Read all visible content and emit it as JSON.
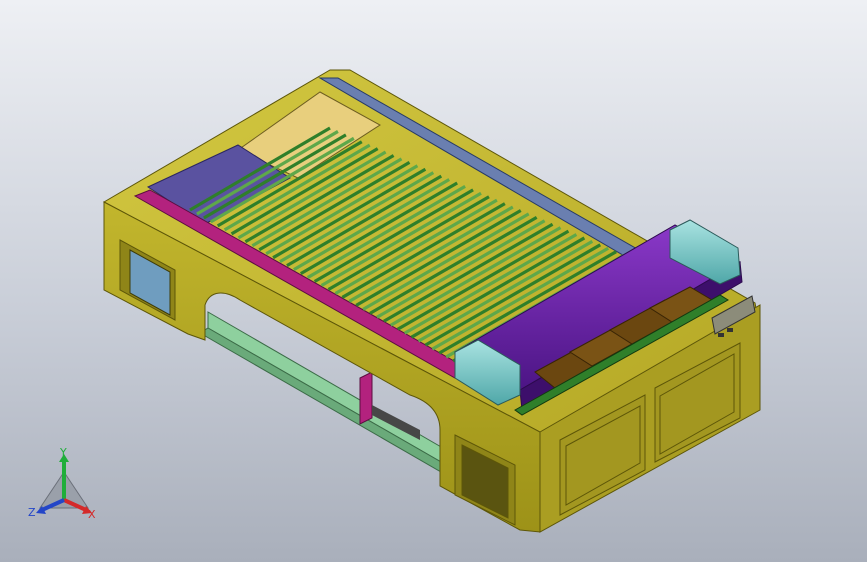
{
  "viewport": {
    "background_top": "#eef0f4",
    "background_bottom": "#a9afbb"
  },
  "colors": {
    "frame": "#b3a623",
    "frame_dark": "#7d7512",
    "frame_top": "#c7bb35",
    "slat_green": "#2f7f2a",
    "slat_light": "#5ea84a",
    "gantry_purple": "#6a1fa6",
    "gantry_dark": "#3d0f6b",
    "teal": "#6fc5c4",
    "brown": "#6b4710",
    "panel_tan": "#e8cf7d",
    "panel_blue": "#5a52a0",
    "rail_magenta": "#b3227e",
    "base_green": "#8ed09e"
  },
  "triad": {
    "y_label": "Y",
    "x_label": "X",
    "z_label": "Z",
    "y_color": "#1fae3a",
    "x_color": "#d42a2a",
    "z_color": "#2446c8"
  }
}
